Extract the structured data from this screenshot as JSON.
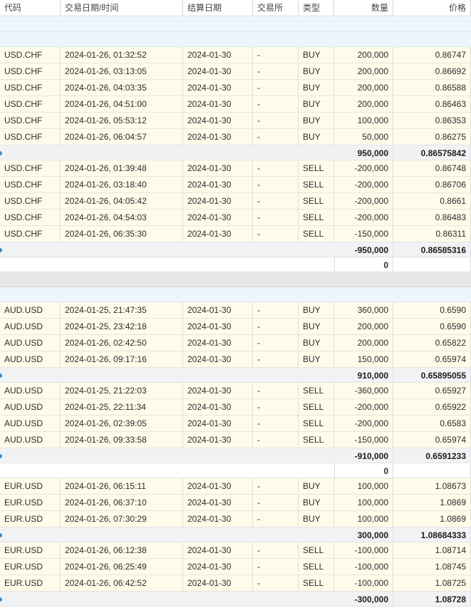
{
  "columns": [
    "代码",
    "交易日期/时间",
    "结算日期",
    "交易所",
    "类型",
    "数量",
    "价格"
  ],
  "rows": [
    {
      "kind": "group"
    },
    {
      "kind": "group"
    },
    {
      "kind": "trade",
      "cells": [
        "USD.CHF",
        "2024-01-26, 01:32:52",
        "2024-01-30",
        "-",
        "BUY",
        "200,000",
        "0.86747"
      ]
    },
    {
      "kind": "trade",
      "cells": [
        "USD.CHF",
        "2024-01-26, 03:13:05",
        "2024-01-30",
        "-",
        "BUY",
        "200,000",
        "0.86692"
      ]
    },
    {
      "kind": "trade",
      "cells": [
        "USD.CHF",
        "2024-01-26, 04:03:35",
        "2024-01-30",
        "-",
        "BUY",
        "200,000",
        "0.86588"
      ]
    },
    {
      "kind": "trade",
      "cells": [
        "USD.CHF",
        "2024-01-26, 04:51:00",
        "2024-01-30",
        "-",
        "BUY",
        "200,000",
        "0.86463"
      ]
    },
    {
      "kind": "trade",
      "cells": [
        "USD.CHF",
        "2024-01-26, 05:53:12",
        "2024-01-30",
        "-",
        "BUY",
        "100,000",
        "0.86353"
      ]
    },
    {
      "kind": "trade",
      "cells": [
        "USD.CHF",
        "2024-01-26, 06:04:57",
        "2024-01-30",
        "-",
        "BUY",
        "50,000",
        "0.86275"
      ]
    },
    {
      "kind": "subtotal",
      "qty": "950,000",
      "price": "0.86575842"
    },
    {
      "kind": "trade",
      "cells": [
        "USD.CHF",
        "2024-01-26, 01:39:48",
        "2024-01-30",
        "-",
        "SELL",
        "-200,000",
        "0.86748"
      ]
    },
    {
      "kind": "trade",
      "cells": [
        "USD.CHF",
        "2024-01-26, 03:18:40",
        "2024-01-30",
        "-",
        "SELL",
        "-200,000",
        "0.86706"
      ]
    },
    {
      "kind": "trade",
      "cells": [
        "USD.CHF",
        "2024-01-26, 04:05:42",
        "2024-01-30",
        "-",
        "SELL",
        "-200,000",
        "0.8661"
      ]
    },
    {
      "kind": "trade",
      "cells": [
        "USD.CHF",
        "2024-01-26, 04:54:03",
        "2024-01-30",
        "-",
        "SELL",
        "-200,000",
        "0.86483"
      ]
    },
    {
      "kind": "trade",
      "cells": [
        "USD.CHF",
        "2024-01-26, 06:35:30",
        "2024-01-30",
        "-",
        "SELL",
        "-150,000",
        "0.86311"
      ]
    },
    {
      "kind": "subtotal",
      "qty": "-950,000",
      "price": "0.86585316"
    },
    {
      "kind": "net",
      "qty": "0"
    },
    {
      "kind": "sep"
    },
    {
      "kind": "group"
    },
    {
      "kind": "trade",
      "cells": [
        "AUD.USD",
        "2024-01-25, 21:47:35",
        "2024-01-30",
        "-",
        "BUY",
        "360,000",
        "0.6590"
      ]
    },
    {
      "kind": "trade",
      "cells": [
        "AUD.USD",
        "2024-01-25, 23:42:18",
        "2024-01-30",
        "-",
        "BUY",
        "200,000",
        "0.6590"
      ]
    },
    {
      "kind": "trade",
      "cells": [
        "AUD.USD",
        "2024-01-26, 02:42:50",
        "2024-01-30",
        "-",
        "BUY",
        "200,000",
        "0.65822"
      ]
    },
    {
      "kind": "trade",
      "cells": [
        "AUD.USD",
        "2024-01-26, 09:17:16",
        "2024-01-30",
        "-",
        "BUY",
        "150,000",
        "0.65974"
      ]
    },
    {
      "kind": "subtotal",
      "qty": "910,000",
      "price": "0.65895055"
    },
    {
      "kind": "trade",
      "cells": [
        "AUD.USD",
        "2024-01-25, 21:22:03",
        "2024-01-30",
        "-",
        "SELL",
        "-360,000",
        "0.65927"
      ]
    },
    {
      "kind": "trade",
      "cells": [
        "AUD.USD",
        "2024-01-25, 22:11:34",
        "2024-01-30",
        "-",
        "SELL",
        "-200,000",
        "0.65922"
      ]
    },
    {
      "kind": "trade",
      "cells": [
        "AUD.USD",
        "2024-01-26, 02:39:05",
        "2024-01-30",
        "-",
        "SELL",
        "-200,000",
        "0.6583"
      ]
    },
    {
      "kind": "trade",
      "cells": [
        "AUD.USD",
        "2024-01-26, 09:33:58",
        "2024-01-30",
        "-",
        "SELL",
        "-150,000",
        "0.65974"
      ]
    },
    {
      "kind": "subtotal",
      "qty": "-910,000",
      "price": "0.6591233"
    },
    {
      "kind": "net",
      "qty": "0"
    },
    {
      "kind": "trade",
      "cells": [
        "EUR.USD",
        "2024-01-26, 06:15:11",
        "2024-01-30",
        "-",
        "BUY",
        "100,000",
        "1.08673"
      ]
    },
    {
      "kind": "trade",
      "cells": [
        "EUR.USD",
        "2024-01-26, 06:37:10",
        "2024-01-30",
        "-",
        "BUY",
        "100,000",
        "1.0869"
      ]
    },
    {
      "kind": "trade",
      "cells": [
        "EUR.USD",
        "2024-01-26, 07:30:29",
        "2024-01-30",
        "-",
        "BUY",
        "100,000",
        "1.0869"
      ]
    },
    {
      "kind": "subtotal",
      "qty": "300,000",
      "price": "1.08684333"
    },
    {
      "kind": "trade",
      "cells": [
        "EUR.USD",
        "2024-01-26, 06:12:38",
        "2024-01-30",
        "-",
        "SELL",
        "-100,000",
        "1.08714"
      ]
    },
    {
      "kind": "trade",
      "cells": [
        "EUR.USD",
        "2024-01-26, 06:25:49",
        "2024-01-30",
        "-",
        "SELL",
        "-100,000",
        "1.08745"
      ]
    },
    {
      "kind": "trade",
      "cells": [
        "EUR.USD",
        "2024-01-26, 06:42:52",
        "2024-01-30",
        "-",
        "SELL",
        "-100,000",
        "1.08725"
      ]
    },
    {
      "kind": "subtotal",
      "qty": "-300,000",
      "price": "1.08728"
    }
  ],
  "colors": {
    "trade_bg": "#fffbea",
    "subtotal_bg": "#f1f2f4",
    "group_bg": "#edf5fd",
    "separator_bg": "#e6e7e9",
    "marker": "#2b8fd6"
  }
}
